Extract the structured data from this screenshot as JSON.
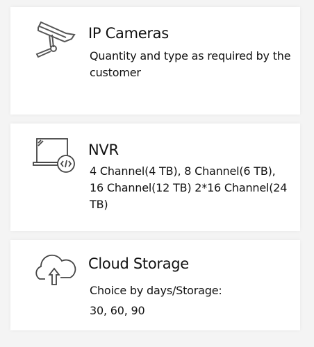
{
  "cards": [
    {
      "title": "IP Cameras",
      "body": "Quantity and type as required by the customer",
      "icon": "security-camera-icon"
    },
    {
      "title": "NVR",
      "body": "4 Channel(4 TB), 8 Channel(6 TB), 16 Channel(12 TB) 2*16 Channel(24 TB)",
      "icon": "laptop-code-icon"
    },
    {
      "title": "Cloud Storage",
      "body": "Choice by days/Storage: 30, 60, 90",
      "icon": "cloud-upload-icon"
    }
  ]
}
